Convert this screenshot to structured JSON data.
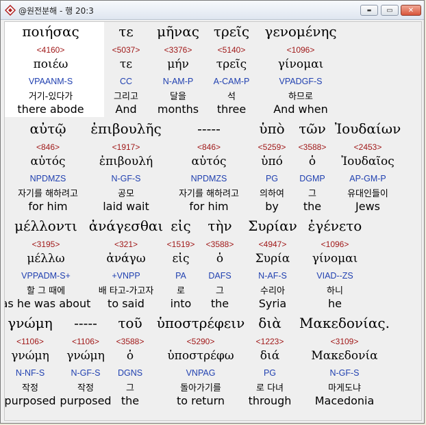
{
  "window": {
    "title": "@원전분해 - 행 20:3",
    "minimize_symbol": "▬",
    "maximize_symbol": "▭",
    "close_symbol": "✕"
  },
  "rows": [
    {
      "words": [
        {
          "greek": "ποιήσας",
          "strong": "<4160>",
          "lemma": "ποιέω",
          "parse": "VPAANM-S",
          "korean": "거기-있다가",
          "english": "there abode"
        },
        {
          "greek": "τε",
          "strong": "<5037>",
          "lemma": "τε",
          "parse": "CC",
          "korean": "그리고",
          "english": "And"
        },
        {
          "greek": "μῆνας",
          "strong": "<3376>",
          "lemma": "μήν",
          "parse": "N-AM-P",
          "korean": "달을",
          "english": "months"
        },
        {
          "greek": "τρεῖς",
          "strong": "<5140>",
          "lemma": "τρεῖς",
          "parse": "A-CAM-P",
          "korean": "석",
          "english": "three"
        },
        {
          "greek": "γενομένης",
          "strong": "<1096>",
          "lemma": "γίνομαι",
          "parse": "VPADGF-S",
          "korean": "하므로",
          "english": "And when"
        }
      ]
    },
    {
      "words": [
        {
          "greek": "αὐτῷ",
          "strong": "<846>",
          "lemma": "αὐτός",
          "parse": "NPDMZS",
          "korean": "자기를 해하려고",
          "english": "for him"
        },
        {
          "greek": "ἐπιβουλῆς",
          "strong": "<1917>",
          "lemma": "ἐπιβουλή",
          "parse": "N-GF-S",
          "korean": "공모",
          "english": "laid wait"
        },
        {
          "greek": "-----",
          "strong": "<846>",
          "lemma": "αὐτός",
          "parse": "NPDMZS",
          "korean": "자기를 해하려고",
          "english": "for him"
        },
        {
          "greek": "ὑπὸ",
          "strong": "<5259>",
          "lemma": "ὑπό",
          "parse": "PG",
          "korean": "의하여",
          "english": "by"
        },
        {
          "greek": "τῶν",
          "strong": "<3588>",
          "lemma": "ὁ",
          "parse": "DGMP",
          "korean": "그",
          "english": "the"
        },
        {
          "greek": "Ἰουδαίων",
          "strong": "<2453>",
          "lemma": "Ἰουδαῖος",
          "parse": "AP-GM-P",
          "korean": "유대인들이",
          "english": "Jews"
        }
      ]
    },
    {
      "words": [
        {
          "greek": "μέλλοντι",
          "strong": "<3195>",
          "lemma": "μέλλω",
          "parse": "VPPADM-S+",
          "korean": "할 그 때에",
          "english": "as he was about"
        },
        {
          "greek": "ἀνάγεσθαι",
          "strong": "<321>",
          "lemma": "ἀνάγω",
          "parse": "+VNPP",
          "korean": "배 타고-가고자",
          "english": "to said"
        },
        {
          "greek": "εἰς",
          "strong": "<1519>",
          "lemma": "εἰς",
          "parse": "PA",
          "korean": "로",
          "english": "into"
        },
        {
          "greek": "τὴν",
          "strong": "<3588>",
          "lemma": "ὁ",
          "parse": "DAFS",
          "korean": "그",
          "english": "the"
        },
        {
          "greek": "Συρίαν",
          "strong": "<4947>",
          "lemma": "Συρία",
          "parse": "N-AF-S",
          "korean": "수리아",
          "english": "Syria"
        },
        {
          "greek": "ἐγένετο",
          "strong": "<1096>",
          "lemma": "γίνομαι",
          "parse": "VIAD--ZS",
          "korean": "하니",
          "english": "he"
        }
      ]
    },
    {
      "words": [
        {
          "greek": "γνώμη",
          "strong": "<1106>",
          "lemma": "γνώμη",
          "parse": "N-NF-S",
          "korean": "작정",
          "english": "purposed"
        },
        {
          "greek": "-----",
          "strong": "<1106>",
          "lemma": "γνώμη",
          "parse": "N-GF-S",
          "korean": "작정",
          "english": "purposed"
        },
        {
          "greek": "τοῦ",
          "strong": "<3588>",
          "lemma": "ὁ",
          "parse": "DGNS",
          "korean": "그",
          "english": "the"
        },
        {
          "greek": "ὑποστρέφειν",
          "strong": "<5290>",
          "lemma": "ὑποστρέφω",
          "parse": "VNPAG",
          "korean": "돌아가기를",
          "english": "to return"
        },
        {
          "greek": "διὰ",
          "strong": "<1223>",
          "lemma": "διά",
          "parse": "PG",
          "korean": "로 다녀",
          "english": "through"
        },
        {
          "greek": "Μακεδονίας.",
          "strong": "<3109>",
          "lemma": "Μακεδονία",
          "parse": "N-GF-S",
          "korean": "마게도냐",
          "english": "Macedonia"
        }
      ]
    }
  ],
  "colors": {
    "strong": "#a01818",
    "parse": "#2040b0",
    "highlight": "#ffffff"
  }
}
